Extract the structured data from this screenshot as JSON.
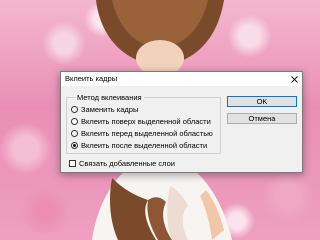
{
  "dialog": {
    "title": "Вклеить кадры",
    "close_icon": "close-icon",
    "group_label": "Метод вклеивания",
    "options": [
      {
        "label": "Заменить кадры",
        "selected": false
      },
      {
        "label": "Вклеить поверх выделенной области",
        "selected": false
      },
      {
        "label": "Вклеить перед выделенной областью",
        "selected": false
      },
      {
        "label": "Вклеить после выделенной области",
        "selected": true
      }
    ],
    "checkbox": {
      "label": "Связать добавленные слои",
      "checked": false
    },
    "buttons": {
      "ok": "OK",
      "cancel": "Отмена"
    },
    "accent_color": "#0078d7"
  }
}
